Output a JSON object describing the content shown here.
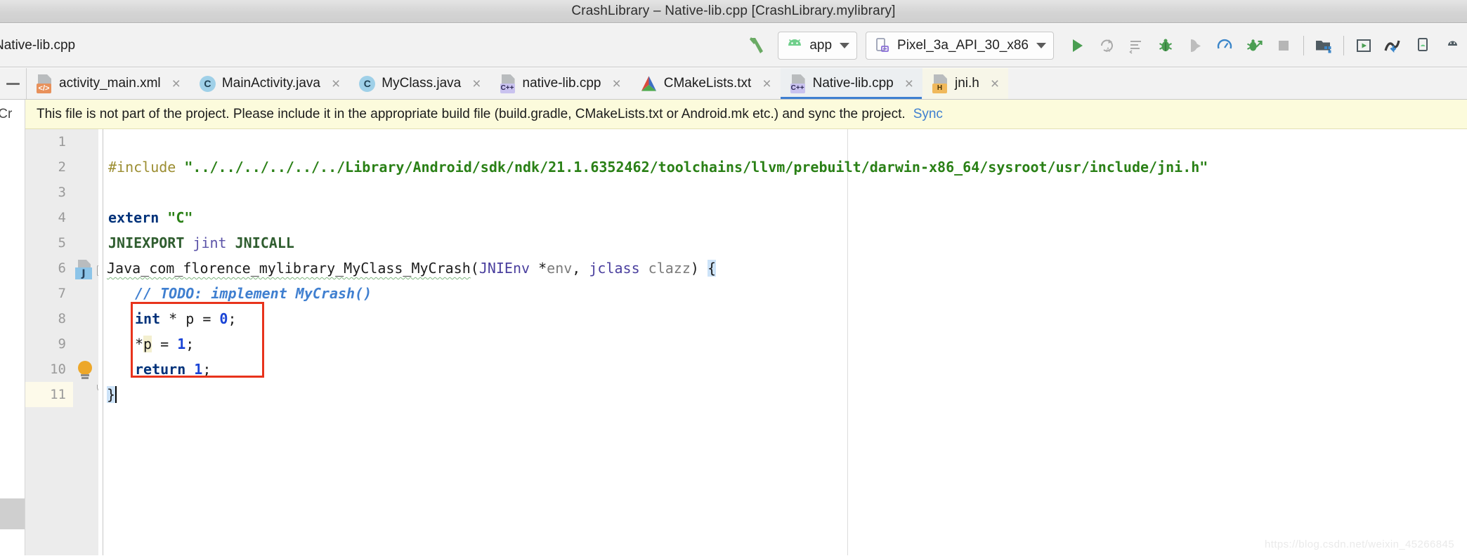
{
  "window": {
    "title": "CrashLibrary – Native-lib.cpp [CrashLibrary.mylibrary]"
  },
  "toolbar": {
    "breadcrumb_file": "Native-lib.cpp",
    "build_icon": "hammer-icon",
    "run_config": {
      "label": "app",
      "icon": "android-head-icon"
    },
    "device": {
      "label": "Pixel_3a_API_30_x86",
      "icon": "device-phone-icon"
    },
    "actions": [
      {
        "name": "run-button",
        "icon": "play-icon"
      },
      {
        "name": "apply-changes-button",
        "icon": "apply-changes-icon"
      },
      {
        "name": "apply-code-changes-button",
        "icon": "apply-code-changes-icon"
      },
      {
        "name": "debug-button",
        "icon": "bug-icon"
      },
      {
        "name": "attach-debugger-button",
        "icon": "attach-debugger-icon"
      },
      {
        "name": "profile-button",
        "icon": "profiler-gauge-icon"
      },
      {
        "name": "attach-debugger-process-button",
        "icon": "bug-attach-icon"
      },
      {
        "name": "stop-button",
        "icon": "stop-square-icon"
      },
      {
        "name": "sdk-manager-button",
        "icon": "sdk-manager-icon"
      },
      {
        "name": "avd-manager-button",
        "icon": "avd-manager-icon"
      },
      {
        "name": "profiler-button",
        "icon": "profiler-icon"
      },
      {
        "name": "layout-inspector-button",
        "icon": "layout-inspector-icon"
      },
      {
        "name": "device-file-explorer-button",
        "icon": "device-explorer-icon"
      }
    ]
  },
  "tabs": [
    {
      "label": "activity_main.xml",
      "icon": "xml-layout-file-icon",
      "badge": "</>",
      "kind": "xml",
      "active": false,
      "close": "×"
    },
    {
      "label": "MainActivity.java",
      "icon": "java-class-icon",
      "badge": "C",
      "kind": "class",
      "active": false,
      "close": "×"
    },
    {
      "label": "MyClass.java",
      "icon": "java-class-icon",
      "badge": "C",
      "kind": "class",
      "active": false,
      "close": "×"
    },
    {
      "label": "native-lib.cpp",
      "icon": "cpp-file-icon",
      "badge": "C++",
      "kind": "cpp",
      "active": false,
      "close": "×"
    },
    {
      "label": "CMakeLists.txt",
      "icon": "cmake-file-icon",
      "badge": "",
      "kind": "cmake",
      "active": false,
      "close": "×"
    },
    {
      "label": "Native-lib.cpp",
      "icon": "cpp-file-icon",
      "badge": "C++",
      "kind": "cpp",
      "active": true,
      "close": "×"
    },
    {
      "label": "jni.h",
      "icon": "header-file-icon",
      "badge": "H",
      "kind": "header",
      "active": false,
      "close": "×"
    }
  ],
  "path_fragment": "/Cr",
  "banner": {
    "message": "This file is not part of the project. Please include it in the appropriate build file (build.gradle, CMakeLists.txt or Android.mk etc.) and sync the project.",
    "link": "Sync"
  },
  "editor": {
    "line_numbers": [
      "1",
      "2",
      "3",
      "4",
      "5",
      "6",
      "7",
      "8",
      "9",
      "10",
      "11"
    ],
    "caret_line": 11,
    "lines": [
      {
        "n": 1,
        "text": ""
      },
      {
        "n": 2,
        "text": "#include \"../../../../../../Library/Android/sdk/ndk/21.1.6352462/toolchains/llvm/prebuilt/darwin-x86_64/sysroot/usr/include/jni.h\""
      },
      {
        "n": 3,
        "text": ""
      },
      {
        "n": 4,
        "text": "extern \"C\""
      },
      {
        "n": 5,
        "text": "JNIEXPORT jint JNICALL"
      },
      {
        "n": 6,
        "text": "Java_com_florence_mylibrary_MyClass_MyCrash(JNIEnv *env, jclass clazz) {"
      },
      {
        "n": 7,
        "text": "    // TODO: implement MyCrash()"
      },
      {
        "n": 8,
        "text": "    int * p = 0;"
      },
      {
        "n": 9,
        "text": "    *p = 1;"
      },
      {
        "n": 10,
        "text": "    return 1;"
      },
      {
        "n": 11,
        "text": "}"
      }
    ],
    "tokens": {
      "l2_directive": "#include ",
      "l2_string": "\"../../../../../../Library/Android/sdk/ndk/21.1.6352462/toolchains/llvm/prebuilt/darwin-x86_64/sysroot/usr/include/jni.h\"",
      "l4_keyword": "extern",
      "l4_string": "\"C\"",
      "l5_macro1": "JNIEXPORT",
      "l5_type": "jint",
      "l5_macro2": "JNICALL",
      "l6_func": "Java_com_florence_mylibrary_MyClass_MyCrash",
      "l6_open_paren": "(",
      "l6_type1": "JNIEnv",
      "l6_star_env": " *",
      "l6_param1": "env",
      "l6_comma": ", ",
      "l6_type2": "jclass",
      "l6_param2": " clazz",
      "l6_close_paren": ") ",
      "l6_brace": "{",
      "l7_comment": "// TODO: implement MyCrash()",
      "l8_kw": "int",
      "l8_mid": " * p = ",
      "l8_num": "0",
      "l8_semi": ";",
      "l9_star": "*",
      "l9_ident": "p",
      "l9_eq": " = ",
      "l9_num": "1",
      "l9_semi": ";",
      "l10_kw": "return",
      "l10_num": " 1",
      "l10_semi": ";",
      "l11_brace": "}"
    },
    "gutter_marks": {
      "line6_icon": "java-navigate-icon",
      "line6_badge": "J",
      "line10_icon": "intention-bulb-icon",
      "line6_fold": "fold-collapse-icon",
      "line11_fold": "fold-end-icon"
    },
    "error_highlight": {
      "name": "null-pointer-error-outline",
      "color": "#e8331c",
      "lines": [
        8,
        9,
        10
      ]
    }
  },
  "watermark": "https://blog.csdn.net/weixin_45266845"
}
